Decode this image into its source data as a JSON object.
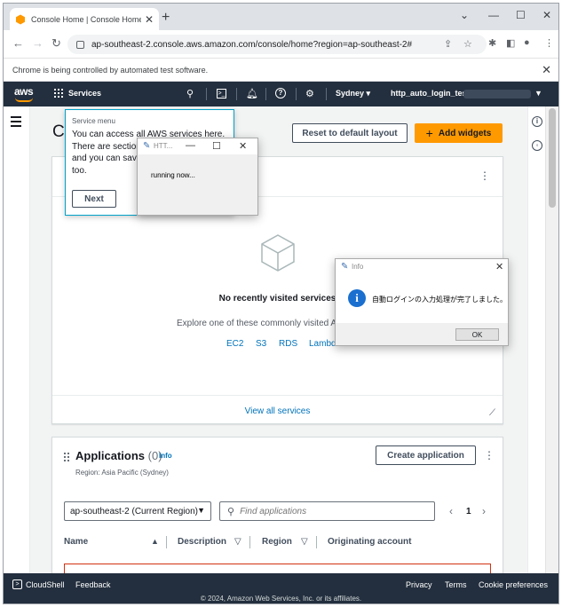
{
  "browser": {
    "tab_title": "Console Home | Console Home",
    "url": "ap-southeast-2.console.aws.amazon.com/console/home?region=ap-southeast-2#",
    "automation_notice": "Chrome is being controlled by automated test software."
  },
  "aws_nav": {
    "logo": "aws",
    "services_label": "Services",
    "region": "Sydney ▾",
    "account": "http_auto_login_test"
  },
  "console": {
    "title": "Co",
    "reset_button": "Reset to default layout",
    "add_widgets_button": "Add widgets",
    "recent": {
      "empty_title": "No recently visited services",
      "empty_subtitle": "Explore one of these commonly visited AW",
      "links": [
        "EC2",
        "S3",
        "RDS",
        "Lambda"
      ],
      "view_all": "View all services"
    },
    "applications": {
      "title": "Applications",
      "count": "(0)",
      "info": "Info",
      "region_text": "Region: Asia Pacific (Sydney)",
      "create_button": "Create application",
      "region_select": "ap-southeast-2 (Current Region)",
      "search_placeholder": "Find applications",
      "page": "1",
      "columns": [
        "Name",
        "Description",
        "Region",
        "Originating account"
      ]
    }
  },
  "popover": {
    "header": "Service menu",
    "body": "You can access all AWS services here. There are section and you can save too.",
    "lines": [
      "You can access all AWS services here.",
      "There are section",
      "and you can save",
      "too."
    ],
    "next_button": "Next"
  },
  "running_dialog": {
    "title": "HTT...",
    "message": "running now..."
  },
  "info_dialog": {
    "title": "Info",
    "message": "自動ログインの入力処理が完了しました。",
    "ok_button": "OK"
  },
  "footer": {
    "cloudshell": "CloudShell",
    "feedback": "Feedback",
    "privacy": "Privacy",
    "terms": "Terms",
    "cookie": "Cookie preferences",
    "copyright": "© 2024, Amazon Web Services, Inc. or its affiliates."
  },
  "colors": {
    "aws_nav_bg": "#232f3e",
    "aws_orange": "#ff9900",
    "link_blue": "#0073bb"
  }
}
